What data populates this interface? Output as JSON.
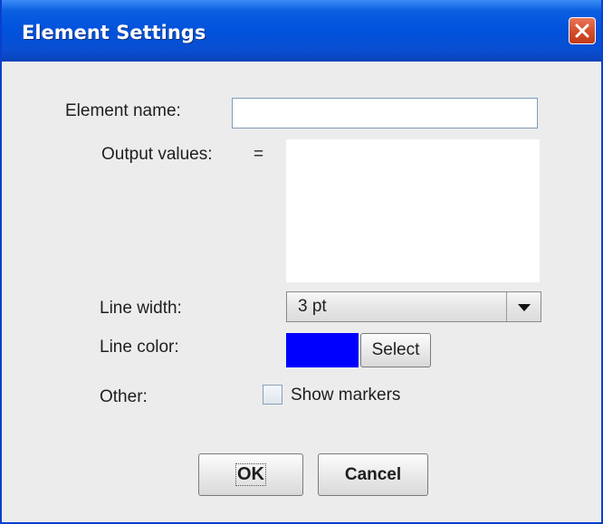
{
  "dialog": {
    "title": "Element Settings"
  },
  "form": {
    "element_name_label": "Element name:",
    "element_name_value": "",
    "output_values_label": "Output values:",
    "output_values_equals": "=",
    "output_values_value": "",
    "line_width_label": "Line width:",
    "line_width_value": "3 pt",
    "line_color_label": "Line color:",
    "line_color_value": "#0000ff",
    "select_button_label": "Select",
    "other_label": "Other:",
    "show_markers_label": "Show markers",
    "show_markers_checked": false
  },
  "buttons": {
    "ok_label": "OK",
    "cancel_label": "Cancel"
  },
  "icons": {
    "close": "close-icon",
    "dropdown": "chevron-down-icon"
  },
  "colors": {
    "titlebar": "#0052dc",
    "close_button": "#d4502c",
    "line_color": "#0000ff",
    "dialog_background": "#ececec"
  }
}
